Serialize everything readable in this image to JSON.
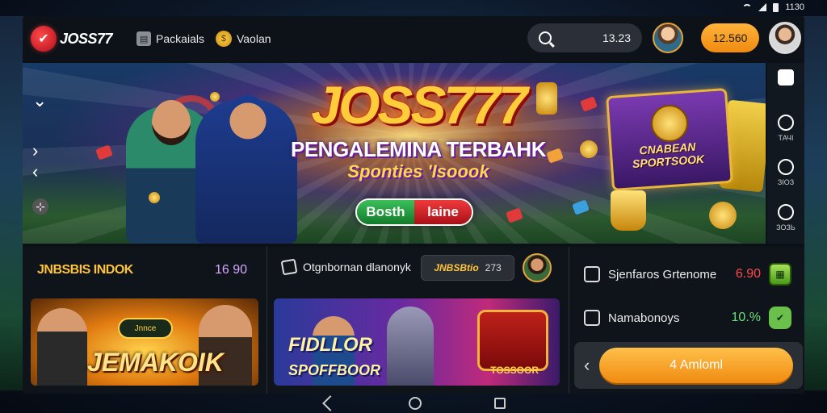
{
  "status_bar": {
    "time": "1130"
  },
  "header": {
    "logo_mark": "✔",
    "logo_text": "JOSS77",
    "nav": [
      {
        "label": "Packaials",
        "icon": "box-icon"
      },
      {
        "label": "Vaolan",
        "icon": "coin-icon"
      }
    ],
    "search": {
      "value": "13.23"
    },
    "balance": "12.560"
  },
  "hero": {
    "title": "JOSS777",
    "subtitle": "PENGALEMINA TERBAHK",
    "tagline": "Sponties 'Isoook",
    "cta_left": "Bosth",
    "cta_right": "laine",
    "card_label": "CNABEAN SPORTSOOK"
  },
  "rail": [
    {
      "label": "",
      "icon": "square-icon"
    },
    {
      "label": "ТАЧІ",
      "icon": "circle-icon"
    },
    {
      "label": "ЗІОЗ",
      "icon": "timer-icon"
    },
    {
      "label": "ЗОЗЬ",
      "icon": "compass-icon"
    }
  ],
  "section_a": {
    "title": "JNBSBIS INDOK",
    "count": "16 90",
    "tile_badge": "Jnnce",
    "tile_label": "JEMAKOIK"
  },
  "section_b": {
    "heading": "Otgnbornan dlanonyk",
    "chip_label": "JNBSBtio",
    "chip_num": "273",
    "tile_label_line1": "FIDLLOR",
    "tile_label_line2": "SPOFFBOOR",
    "machine_label": "TOSSOOR"
  },
  "section_c": {
    "rows": [
      {
        "label": "Sjenfaros Grtenome",
        "value": "6.90",
        "value_color": "#ff4a4a"
      },
      {
        "label": "Namabonoys",
        "value": "10.%",
        "value_color": "#6ae07a"
      }
    ],
    "action_label": "4 Amloml"
  },
  "colors": {
    "accent_orange": "#f08a10",
    "gold": "#ffc43a",
    "panel": "#0f141b"
  }
}
